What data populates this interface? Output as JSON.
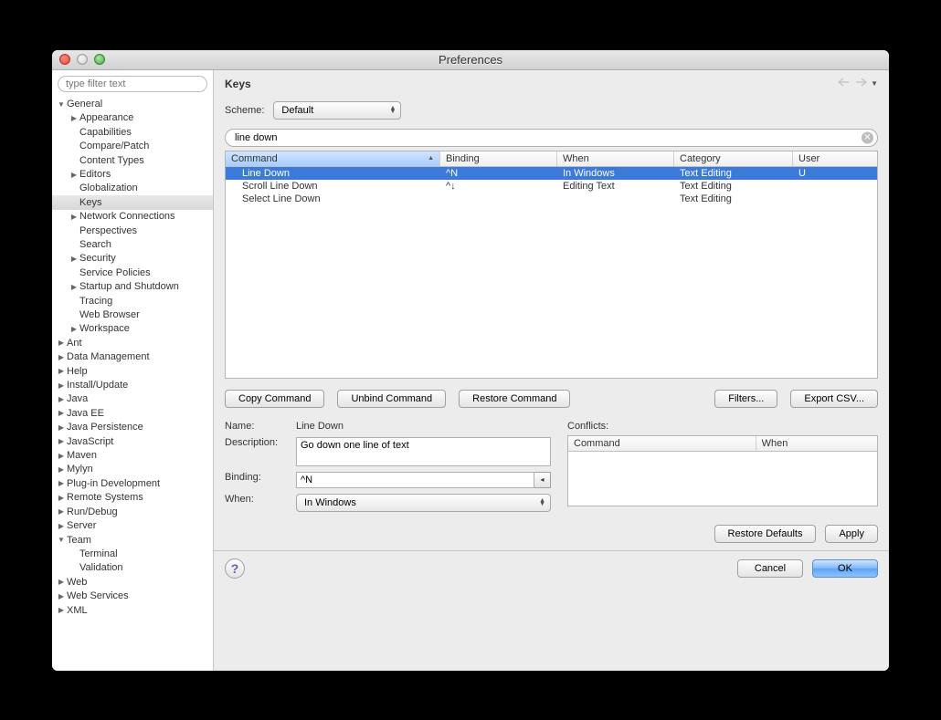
{
  "window": {
    "title": "Preferences"
  },
  "sidebar": {
    "filter_placeholder": "type filter text",
    "tree": [
      {
        "label": "General",
        "depth": 0,
        "arrow": "down",
        "sel": false
      },
      {
        "label": "Appearance",
        "depth": 1,
        "arrow": "right",
        "sel": false
      },
      {
        "label": "Capabilities",
        "depth": 1,
        "arrow": "none",
        "sel": false
      },
      {
        "label": "Compare/Patch",
        "depth": 1,
        "arrow": "none",
        "sel": false
      },
      {
        "label": "Content Types",
        "depth": 1,
        "arrow": "none",
        "sel": false
      },
      {
        "label": "Editors",
        "depth": 1,
        "arrow": "right",
        "sel": false
      },
      {
        "label": "Globalization",
        "depth": 1,
        "arrow": "none",
        "sel": false
      },
      {
        "label": "Keys",
        "depth": 1,
        "arrow": "none",
        "sel": true
      },
      {
        "label": "Network Connections",
        "depth": 1,
        "arrow": "right",
        "sel": false
      },
      {
        "label": "Perspectives",
        "depth": 1,
        "arrow": "none",
        "sel": false
      },
      {
        "label": "Search",
        "depth": 1,
        "arrow": "none",
        "sel": false
      },
      {
        "label": "Security",
        "depth": 1,
        "arrow": "right",
        "sel": false
      },
      {
        "label": "Service Policies",
        "depth": 1,
        "arrow": "none",
        "sel": false
      },
      {
        "label": "Startup and Shutdown",
        "depth": 1,
        "arrow": "right",
        "sel": false
      },
      {
        "label": "Tracing",
        "depth": 1,
        "arrow": "none",
        "sel": false
      },
      {
        "label": "Web Browser",
        "depth": 1,
        "arrow": "none",
        "sel": false
      },
      {
        "label": "Workspace",
        "depth": 1,
        "arrow": "right",
        "sel": false
      },
      {
        "label": "Ant",
        "depth": 0,
        "arrow": "right",
        "sel": false
      },
      {
        "label": "Data Management",
        "depth": 0,
        "arrow": "right",
        "sel": false
      },
      {
        "label": "Help",
        "depth": 0,
        "arrow": "right",
        "sel": false
      },
      {
        "label": "Install/Update",
        "depth": 0,
        "arrow": "right",
        "sel": false
      },
      {
        "label": "Java",
        "depth": 0,
        "arrow": "right",
        "sel": false
      },
      {
        "label": "Java EE",
        "depth": 0,
        "arrow": "right",
        "sel": false
      },
      {
        "label": "Java Persistence",
        "depth": 0,
        "arrow": "right",
        "sel": false
      },
      {
        "label": "JavaScript",
        "depth": 0,
        "arrow": "right",
        "sel": false
      },
      {
        "label": "Maven",
        "depth": 0,
        "arrow": "right",
        "sel": false
      },
      {
        "label": "Mylyn",
        "depth": 0,
        "arrow": "right",
        "sel": false
      },
      {
        "label": "Plug-in Development",
        "depth": 0,
        "arrow": "right",
        "sel": false
      },
      {
        "label": "Remote Systems",
        "depth": 0,
        "arrow": "right",
        "sel": false
      },
      {
        "label": "Run/Debug",
        "depth": 0,
        "arrow": "right",
        "sel": false
      },
      {
        "label": "Server",
        "depth": 0,
        "arrow": "right",
        "sel": false
      },
      {
        "label": "Team",
        "depth": 0,
        "arrow": "down",
        "sel": false
      },
      {
        "label": "Terminal",
        "depth": 1,
        "arrow": "none",
        "sel": false
      },
      {
        "label": "Validation",
        "depth": 1,
        "arrow": "none",
        "sel": false
      },
      {
        "label": "Web",
        "depth": 0,
        "arrow": "right",
        "sel": false
      },
      {
        "label": "Web Services",
        "depth": 0,
        "arrow": "right",
        "sel": false
      },
      {
        "label": "XML",
        "depth": 0,
        "arrow": "right",
        "sel": false
      }
    ]
  },
  "page": {
    "title": "Keys",
    "scheme_label": "Scheme:",
    "scheme_value": "Default",
    "search_value": "line down",
    "columns": {
      "command": "Command",
      "binding": "Binding",
      "when": "When",
      "category": "Category",
      "user": "User"
    },
    "rows": [
      {
        "command": "Line Down",
        "binding": "^N",
        "when": "In Windows",
        "category": "Text Editing",
        "user": "U",
        "selected": true
      },
      {
        "command": "Scroll Line Down",
        "binding": "^↓",
        "when": "Editing Text",
        "category": "Text Editing",
        "user": "",
        "selected": false
      },
      {
        "command": "Select Line Down",
        "binding": "",
        "when": "",
        "category": "Text Editing",
        "user": "",
        "selected": false
      }
    ],
    "buttons": {
      "copy": "Copy Command",
      "unbind": "Unbind Command",
      "restore": "Restore Command",
      "filters": "Filters...",
      "export": "Export CSV..."
    },
    "details": {
      "name_label": "Name:",
      "name_value": "Line Down",
      "desc_label": "Description:",
      "desc_value": "Go down one line of text",
      "binding_label": "Binding:",
      "binding_value": "^N",
      "when_label": "When:",
      "when_value": "In Windows",
      "conflicts_label": "Conflicts:",
      "conflicts_cols": {
        "command": "Command",
        "when": "When"
      }
    },
    "footer": {
      "restore_defaults": "Restore Defaults",
      "apply": "Apply"
    }
  },
  "dialog_buttons": {
    "cancel": "Cancel",
    "ok": "OK"
  }
}
